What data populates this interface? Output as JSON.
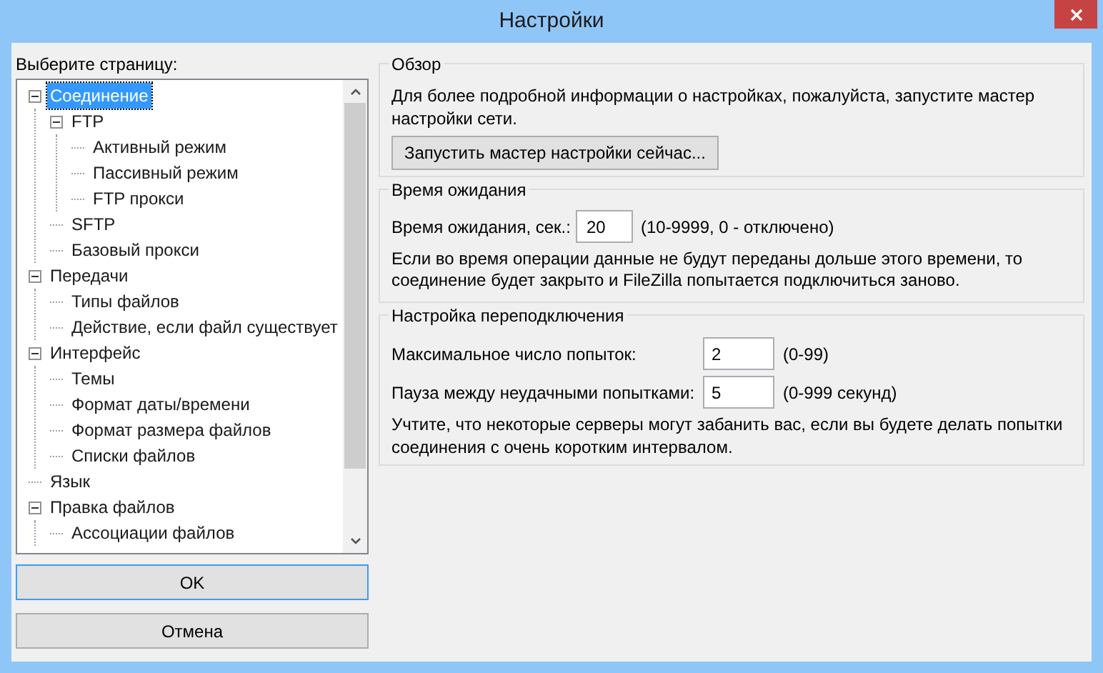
{
  "window": {
    "title": "Настройки"
  },
  "page_picker": {
    "label": "Выберите страницу:",
    "tree": [
      {
        "label": "Соединение",
        "selected": true,
        "expanded": true,
        "children": [
          {
            "label": "FTP",
            "selected": false,
            "expanded": true,
            "children": [
              {
                "label": "Активный режим",
                "selected": false
              },
              {
                "label": "Пассивный режим",
                "selected": false
              },
              {
                "label": "FTP прокси",
                "selected": false
              }
            ]
          },
          {
            "label": "SFTP",
            "selected": false
          },
          {
            "label": "Базовый прокси",
            "selected": false
          }
        ]
      },
      {
        "label": "Передачи",
        "selected": false,
        "expanded": true,
        "children": [
          {
            "label": "Типы файлов",
            "selected": false
          },
          {
            "label": "Действие, если файл существует",
            "selected": false
          }
        ]
      },
      {
        "label": "Интерфейс",
        "selected": false,
        "expanded": true,
        "children": [
          {
            "label": "Темы",
            "selected": false
          },
          {
            "label": "Формат даты/времени",
            "selected": false
          },
          {
            "label": "Формат размера файлов",
            "selected": false
          },
          {
            "label": "Списки файлов",
            "selected": false
          }
        ]
      },
      {
        "label": "Язык",
        "selected": false
      },
      {
        "label": "Правка файлов",
        "selected": false,
        "expanded": true,
        "children": [
          {
            "label": "Ассоциации файлов",
            "selected": false
          }
        ]
      }
    ]
  },
  "buttons": [
    {
      "label": "OK",
      "default": true
    },
    {
      "label": "Отмена",
      "default": false
    }
  ],
  "overview": {
    "title": "Обзор",
    "text": "Для более подробной информации о настройках, пожалуйста, запустите мастер настройки сети.",
    "button": "Запустить мастер настройки сейчас..."
  },
  "timeout": {
    "title": "Время ожидания",
    "field_label": "Время ожидания, сек.:",
    "value": "20",
    "range": "(10-9999, 0 - отключено)",
    "note": "Если во время операции данные не будут переданы дольше этого времени, то соединение будет закрыто и FileZilla попытается подключиться заново."
  },
  "reconnect": {
    "title": "Настройка переподключения",
    "fields": [
      {
        "label": "Максимальное число попыток:",
        "value": "2",
        "range": "(0-99)"
      },
      {
        "label": "Пауза между неудачными попытками:",
        "value": "5",
        "range": "(0-999 секунд)"
      }
    ],
    "note": "Учтите, что некоторые серверы могут забанить вас, если вы будете делать попытки соединения с очень коротким интервалом."
  }
}
